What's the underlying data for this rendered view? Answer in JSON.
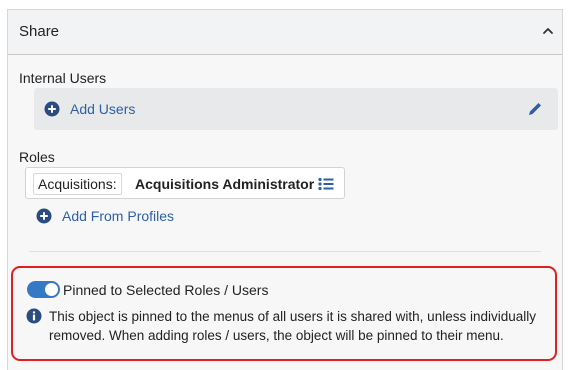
{
  "share": {
    "title": "Share",
    "internal_users": {
      "label": "Internal Users",
      "add_label": "Add Users"
    },
    "roles": {
      "label": "Roles",
      "items": [
        {
          "prefix": "Acquisitions:",
          "name": "Acquisitions Administrator"
        }
      ],
      "add_label": "Add From Profiles"
    },
    "pinned": {
      "label": "Pinned to Selected Roles / Users",
      "enabled": true,
      "info": "This object is pinned to the menus of all users it is shared with, unless individually removed. When adding roles / users, the object will be pinned to their menu."
    }
  },
  "icons": {
    "collapse": "chevron-up-icon",
    "add": "plus-circle-icon",
    "edit": "pencil-icon",
    "list": "list-icon",
    "info": "info-circle-icon"
  },
  "colors": {
    "link": "#2d5fa6",
    "toggle_on": "#3478c6",
    "highlight": "#e02020",
    "info_icon": "#2b4c7e"
  }
}
